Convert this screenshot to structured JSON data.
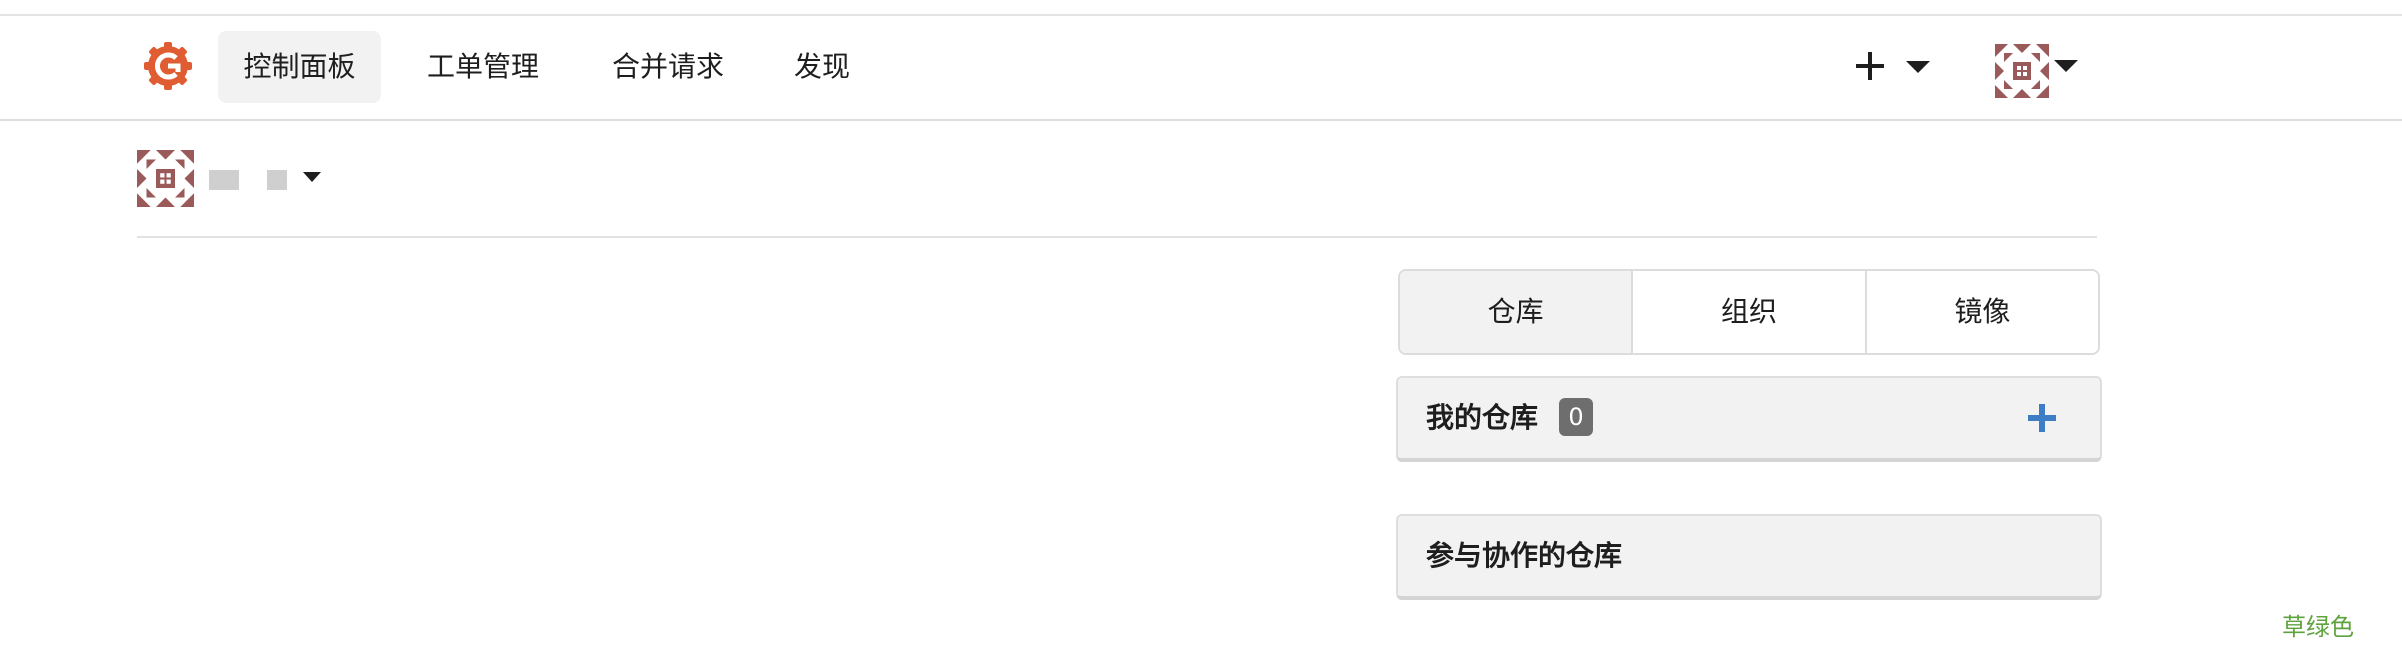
{
  "nav": {
    "items": [
      {
        "label": "控制面板",
        "active": true
      },
      {
        "label": "工单管理",
        "active": false
      },
      {
        "label": "合并请求",
        "active": false
      },
      {
        "label": "发现",
        "active": false
      }
    ],
    "create_icon": "plus-icon",
    "user_menu_icon": "user-avatar"
  },
  "context": {
    "user_name": " ",
    "switcher_icon": "caret-down-icon"
  },
  "tabs": [
    {
      "label": "仓库",
      "active": true
    },
    {
      "label": "组织",
      "active": false
    },
    {
      "label": "镜像",
      "active": false
    }
  ],
  "my_repos": {
    "title": "我的仓库",
    "count": "0",
    "add_icon": "plus-icon"
  },
  "collab_repos": {
    "title": "参与协作的仓库"
  },
  "footer": {
    "theme_label": "草绿色"
  },
  "colors": {
    "accent_plus": "#3d7dc6",
    "theme_label": "#5fa33f",
    "badge_bg": "#6e6e6e",
    "logo": "#e05d34"
  }
}
